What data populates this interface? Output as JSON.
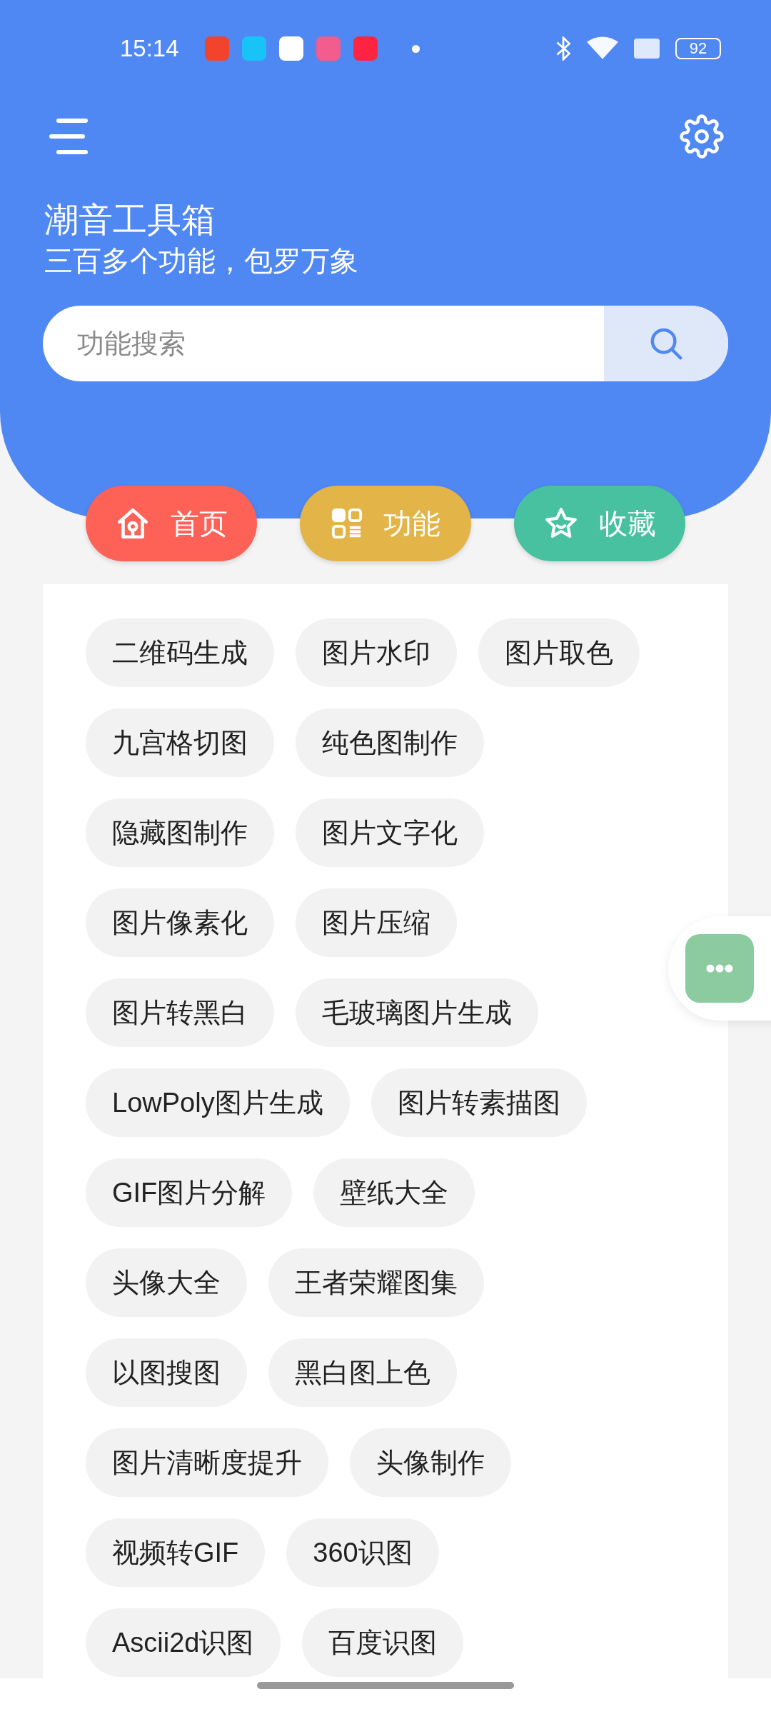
{
  "status_bar": {
    "time": "15:14",
    "battery": "92"
  },
  "header": {
    "title": "潮音工具箱",
    "subtitle": "三百多个功能，包罗万象"
  },
  "search": {
    "placeholder": "功能搜索"
  },
  "nav": [
    {
      "label": "首页",
      "kind": "home",
      "color": "#fe6156"
    },
    {
      "label": "功能",
      "kind": "grid",
      "color": "#e3b447"
    },
    {
      "label": "收藏",
      "kind": "star",
      "color": "#47c19f"
    }
  ],
  "features": [
    "二维码生成",
    "图片水印",
    "图片取色",
    "九宫格切图",
    "纯色图制作",
    "隐藏图制作",
    "图片文字化",
    "图片像素化",
    "图片压缩",
    "图片转黑白",
    "毛玻璃图片生成",
    "LowPoly图片生成",
    "图片转素描图",
    "GIF图片分解",
    "壁纸大全",
    "头像大全",
    "王者荣耀图集",
    "以图搜图",
    "黑白图上色",
    "图片清晰度提升",
    "头像制作",
    "视频转GIF",
    "360识图",
    "Ascii2d识图",
    "百度识图"
  ]
}
